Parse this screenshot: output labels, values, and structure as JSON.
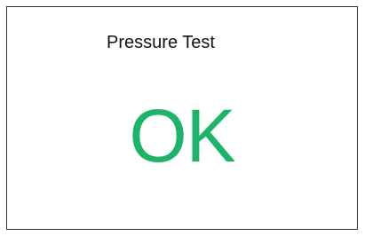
{
  "panel": {
    "title": "Pressure Test",
    "status_text": "OK",
    "status_color": "#1db46a"
  }
}
